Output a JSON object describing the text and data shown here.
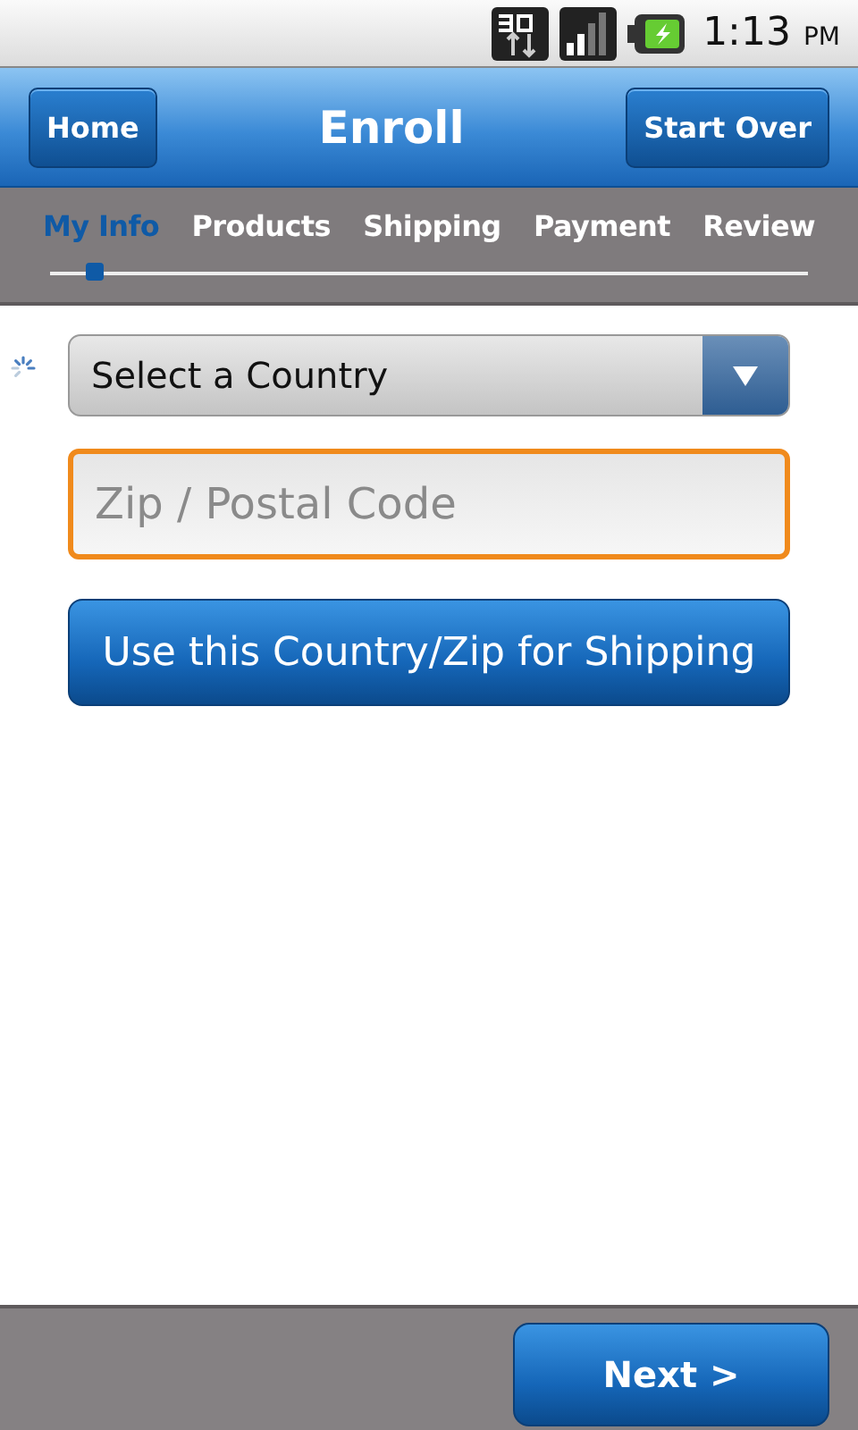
{
  "status_bar": {
    "time": "1:13",
    "ampm": "PM"
  },
  "header": {
    "title": "Enroll",
    "left_button": "Home",
    "right_button": "Start Over"
  },
  "steps": [
    {
      "label": "My Info",
      "selected": true
    },
    {
      "label": "Products",
      "selected": false
    },
    {
      "label": "Shipping",
      "selected": false
    },
    {
      "label": "Payment",
      "selected": false
    },
    {
      "label": "Review",
      "selected": false
    }
  ],
  "progress": {
    "level": 0.06
  },
  "country_select": {
    "value": "Select a Country"
  },
  "zip_field": {
    "placeholder": "Zip / Postal Code",
    "focused": true
  },
  "shipping_button": "Use this Country/Zip for Shipping",
  "footer": {
    "next_button": "Next >"
  }
}
